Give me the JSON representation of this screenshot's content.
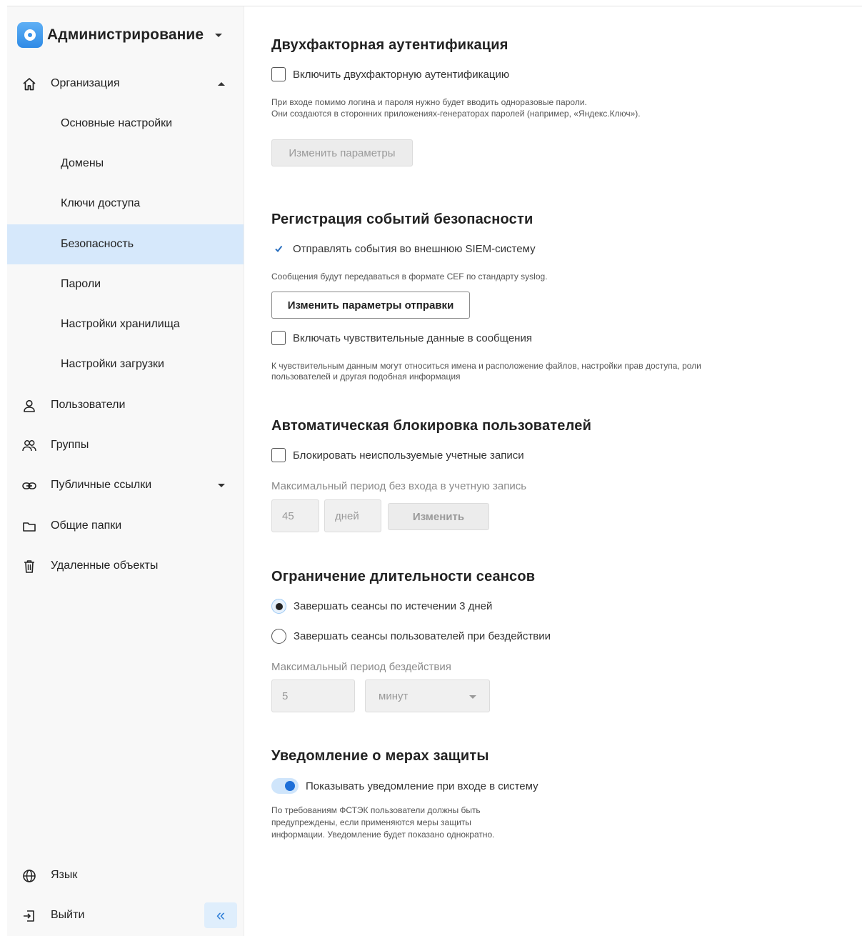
{
  "sidebar": {
    "app_title": "Администрирование",
    "nav": {
      "organization": "Организация",
      "sub_items": [
        {
          "label": "Основные настройки"
        },
        {
          "label": "Домены"
        },
        {
          "label": "Ключи доступа"
        },
        {
          "label": "Безопасность",
          "active": true
        },
        {
          "label": "Пароли"
        },
        {
          "label": "Настройки хранилища"
        },
        {
          "label": "Настройки загрузки"
        }
      ],
      "users": "Пользователи",
      "groups": "Группы",
      "public_links": "Публичные ссылки",
      "shared_folders": "Общие папки",
      "deleted_objects": "Удаленные объекты"
    },
    "footer": {
      "language": "Язык",
      "logout": "Выйти",
      "collapse_glyph": "«"
    }
  },
  "two_factor": {
    "title": "Двухфакторная аутентификация",
    "checkbox_label": "Включить двухфакторную аутентификацию",
    "checked": false,
    "hint_line1": "При входе помимо логина и пароля нужно будет вводить одноразовые пароли.",
    "hint_line2": "Они создаются в сторонних приложениях-генераторах паролей (например, «Яндекс.Ключ»).",
    "button": "Изменить параметры"
  },
  "event_logging": {
    "title": "Регистрация событий безопасности",
    "send_label": "Отправлять события во внешнюю SIEM-систему",
    "send_checked": true,
    "send_hint": "Сообщения будут передаваться в формате CEF по стандарту syslog.",
    "button": "Изменить параметры отправки",
    "sensitive_label": "Включать чувствительные данные в сообщения",
    "sensitive_checked": false,
    "sensitive_hint_line1": "К чувствительным данным могут относиться имена и расположение файлов, настройки прав доступа, роли",
    "sensitive_hint_line2": "пользователей и другая подобная информация"
  },
  "auto_block": {
    "title": "Автоматическая блокировка пользователей",
    "checkbox_label": "Блокировать неиспользуемые учетные записи",
    "checked": false,
    "period_label": "Максимальный период без входа в учетную запись",
    "period_value": "45",
    "period_unit": "дней",
    "button": "Изменить"
  },
  "session_limit": {
    "title": "Ограничение длительности сеансов",
    "option1": "Завершать сеансы по истечении 3 дней",
    "option2": "Завершать сеансы пользователей при бездействии",
    "selected_option": 1,
    "idle_label": "Максимальный период бездействия",
    "idle_value": "5",
    "idle_unit": "минут"
  },
  "notice": {
    "title": "Уведомление о мерах защиты",
    "toggle_label": "Показывать уведомление при входе в систему",
    "toggle_on": true,
    "hint_line1": "По требованиям ФСТЭК пользователи должны быть",
    "hint_line2": "предупреждены, если применяются меры защиты",
    "hint_line3": "информации. Уведомление будет показано однократно."
  },
  "colors": {
    "accent": "#1e6fd8",
    "active_nav_bg": "#d6e8fb",
    "sidebar_bg": "#f8f8f8"
  }
}
